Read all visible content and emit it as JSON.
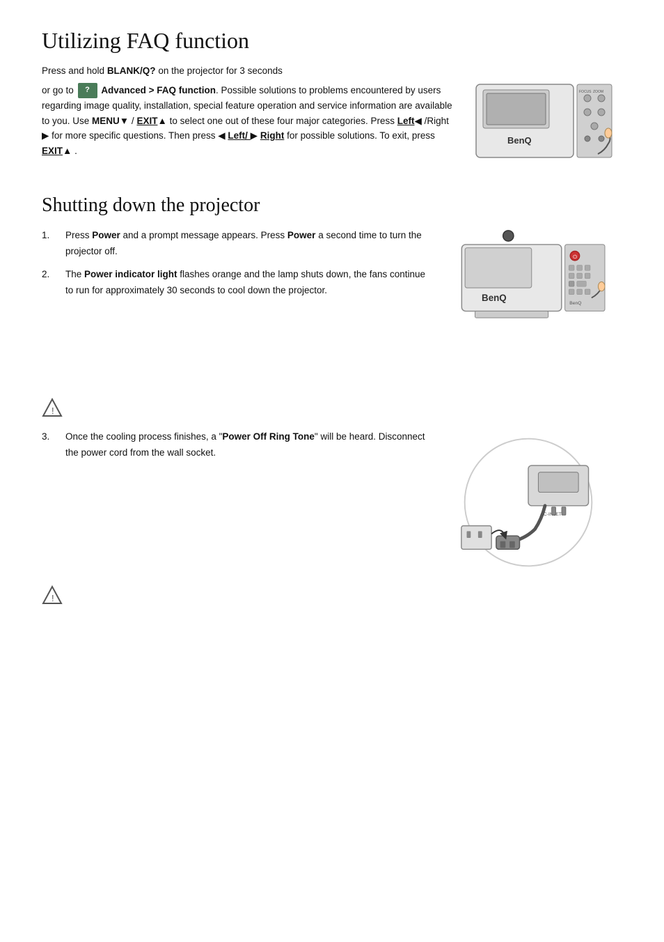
{
  "faq": {
    "title": "Utilizing FAQ function",
    "para1": "Press and hold ",
    "blank_q": "BLANK/Q?",
    "para1b": " on the projector for 3 seconds",
    "para2a": "or go to",
    "advanced": "Advanced > FAQ function",
    "para2b": ". Possible solutions to problems encountered by users regarding image quality, installation, special feature operation and service information are available to you. Use ",
    "menu": "MENU",
    "menu_arrow": "▼",
    "slash": " / ",
    "exit": "EXIT",
    "exit_arrow": "▲",
    "para3": " to select one out of these four major categories. Press ",
    "left": "Left",
    "left_arrow": "◀",
    "slash2": " /Right ",
    "right_arrow": "▶",
    "para4": " for more specific questions. Then press ",
    "left2": "◀",
    "left2b": " Left/ ",
    "right2": "▶",
    "right2b": " Right",
    "para5": " for possible solutions. To exit, press ",
    "exit2": "EXIT",
    "exit2_arrow": "▲",
    "period": " ."
  },
  "shutdown": {
    "title": "Shutting down the projector",
    "step1_num": "1.",
    "step1_text1": "Press ",
    "step1_power1": "Power",
    "step1_text2": " and a prompt message appears. Press ",
    "step1_power2": "Power",
    "step1_text3": " a second time to turn the projector off.",
    "step2_num": "2.",
    "step2_text1": "The ",
    "step2_power": "Power indicator light",
    "step2_text2": " flashes orange and the lamp shuts down, the fans continue to run for approximately 30 seconds to cool down the projector.",
    "step3_num": "3.",
    "step3_text1": "Once the cooling process finishes, a \"",
    "step3_power": "Power Off Ring Tone",
    "step3_text2": "\" will be heard. Disconnect the power cord from the wall socket."
  }
}
